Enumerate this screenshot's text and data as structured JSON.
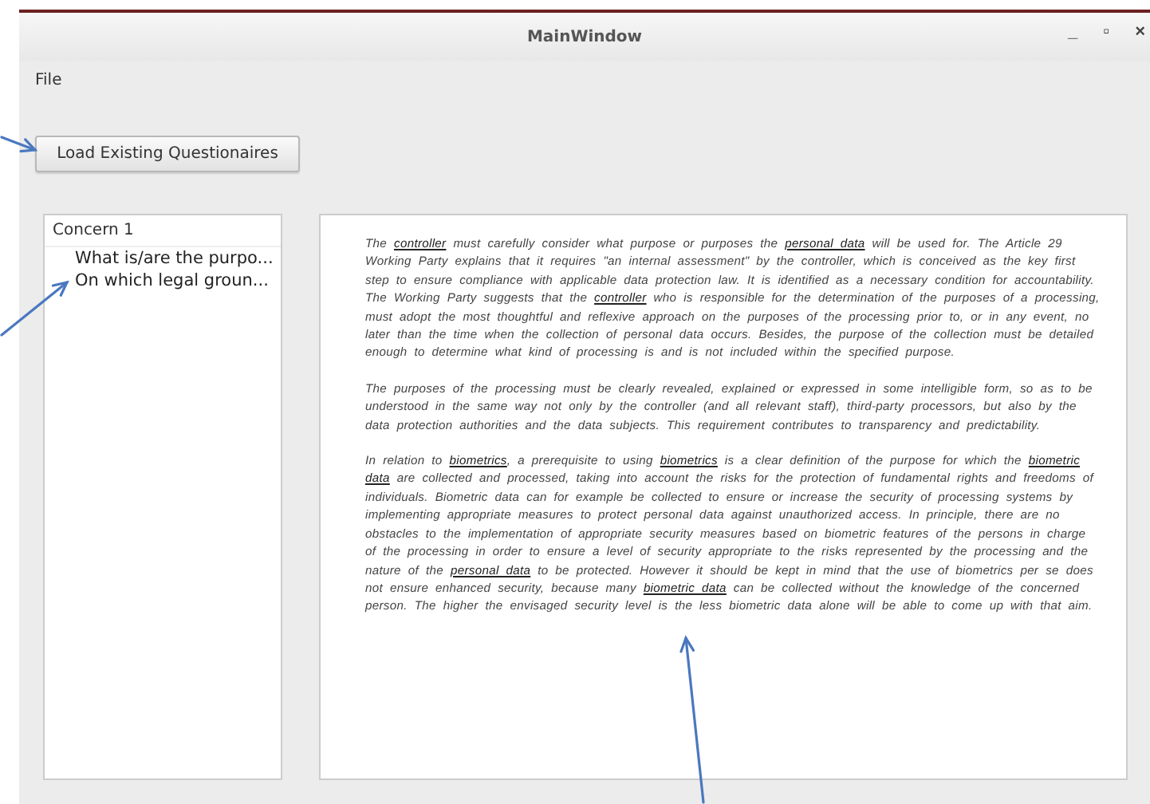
{
  "window": {
    "title": "MainWindow",
    "controls": [
      "_",
      "▫",
      "×"
    ]
  },
  "menu": [
    "File"
  ],
  "load_button": "Load Existing Questionaires",
  "tree": [
    {
      "label": "Concern 1",
      "children": [
        {
          "label": "What is/are the purpo..."
        },
        {
          "label": "On which legal groun..."
        }
      ]
    }
  ],
  "document": {
    "paragraphs": [
      "The *controller* must carefully consider what purpose or purposes the *personal data* will be used for. The Article 29 Working Party explains that it requires \"an internal assessment\" by the controller, which is conceived as the key first step to ensure compliance with applicable data protection law. It is identified as a necessary condition for accountability. The Working Party suggests that the *controller* who is responsible for the determination of the purposes of a processing, must adopt the most thoughtful and reflexive approach on the purposes of the processing prior to, or in any event, no later than the time when the collection of personal data occurs. Besides, the purpose of the collection must be detailed enough to determine what kind of processing is and is not included within the specified purpose.",
      "The purposes of the processing must be clearly revealed, explained or expressed in some intelligible form, so as to be understood in the same way not only by the controller (and all relevant staff), third-party processors, but also by the data protection authorities and the data subjects. This requirement contributes to transparency and predictability.",
      "In relation to *biometrics*, a prerequisite to using *biometrics* is a clear definition of the purpose for which the *biometric data* are collected and processed, taking into account the risks for the protection of fundamental rights and freedoms of individuals. Biometric data can for example be collected to ensure or increase the security of processing systems by implementing appropriate measures to protect personal data against unauthorized access. In principle, there are no obstacles to the implementation of appropriate security measures based on biometric features of the persons in charge of the processing in order to ensure a level of security appropriate to the risks represented by the processing and the nature of the *personal data* to be protected. However it should be kept in mind that the use of biometrics per se does not ensure enhanced security, because many *biometric data* can be collected without the knowledge of the concerned person. The higher the envisaged security level is the less biometric data alone will be able to come up with that aim."
    ]
  }
}
